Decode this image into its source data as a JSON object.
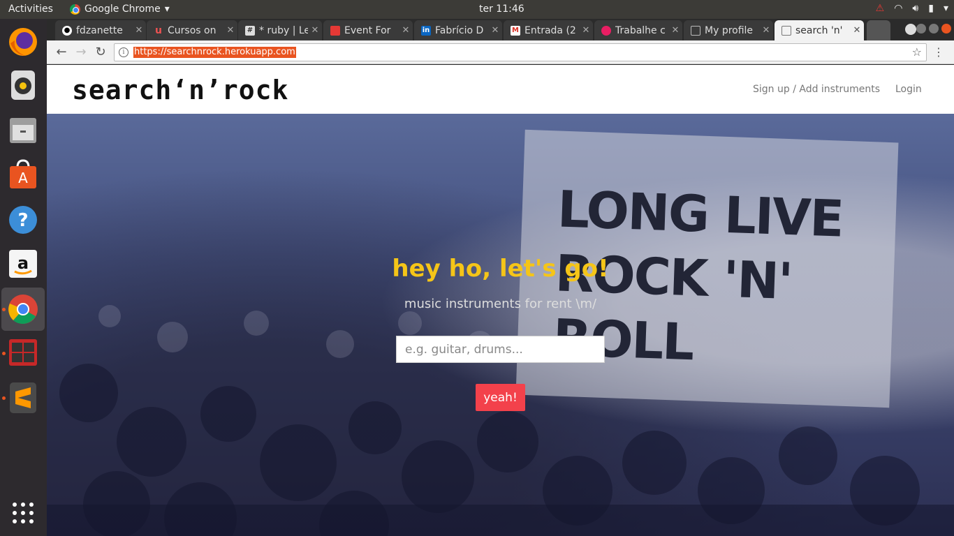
{
  "topbar": {
    "activities": "Activities",
    "app_name": "Google Chrome",
    "clock": "ter 11:46"
  },
  "tabs": [
    {
      "label": "fdzanette",
      "icon": "github-icon"
    },
    {
      "label": "Cursos on",
      "icon": "udemy-icon"
    },
    {
      "label": "* ruby | Le",
      "icon": "slack-icon"
    },
    {
      "label": "Event For",
      "icon": "event-icon"
    },
    {
      "label": "Fabrício D",
      "icon": "linkedin-icon"
    },
    {
      "label": "Entrada (2",
      "icon": "gmail-icon"
    },
    {
      "label": "Trabalhe c",
      "icon": "job-icon"
    },
    {
      "label": "My profile",
      "icon": "doc-icon"
    },
    {
      "label": "search 'n'",
      "icon": "doc-icon"
    }
  ],
  "omnibox": {
    "url": "https://searchnrock.herokuapp.com"
  },
  "site": {
    "logo": "search‘n’rock",
    "nav": {
      "signup": "Sign up / Add instruments",
      "login": "Login"
    },
    "hero": {
      "banner": "LONG LIVE ROCK 'N' ROLL",
      "tagline": "hey ho, let's go!",
      "subtitle": "music instruments for rent \\m/",
      "search_placeholder": "e.g. guitar, drums...",
      "button": "yeah!"
    }
  },
  "colors": {
    "accent_yellow": "#f5c518",
    "button_red": "#f3414b",
    "ubuntu_orange": "#e95420"
  }
}
